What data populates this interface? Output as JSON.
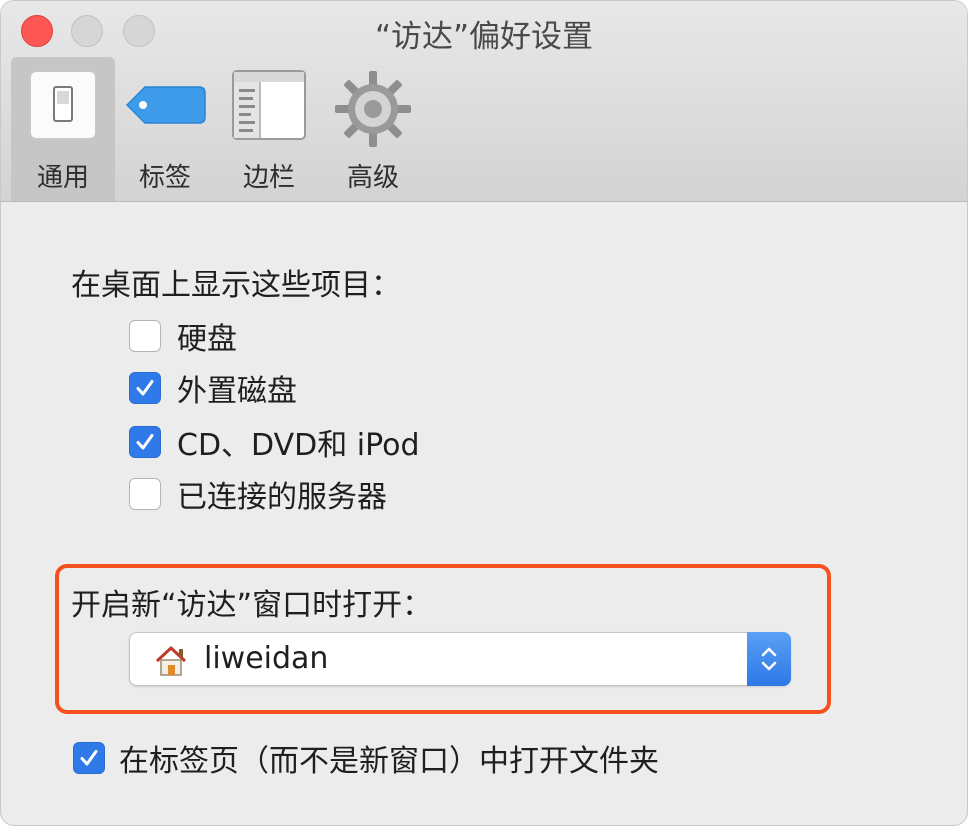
{
  "window": {
    "title": "“访达”偏好设置"
  },
  "toolbar": {
    "tabs": [
      {
        "label": "通用",
        "icon": "switch-icon",
        "selected": true
      },
      {
        "label": "标签",
        "icon": "tag-icon",
        "selected": false
      },
      {
        "label": "边栏",
        "icon": "sidebar-icon",
        "selected": false
      },
      {
        "label": "高级",
        "icon": "gear-icon",
        "selected": false
      }
    ]
  },
  "desktop_items": {
    "heading": "在桌面上显示这些项目：",
    "options": [
      {
        "label": "硬盘",
        "checked": false
      },
      {
        "label": "外置磁盘",
        "checked": true
      },
      {
        "label": "CD、DVD和 iPod",
        "checked": true
      },
      {
        "label": "已连接的服务器",
        "checked": false
      }
    ]
  },
  "new_window": {
    "heading": "开启新“访达”窗口时打开：",
    "selected_value": "liweidan",
    "value_icon": "home-icon"
  },
  "open_in_tabs": {
    "label": "在标签页（而不是新窗口）中打开文件夹",
    "checked": true
  },
  "colors": {
    "accent": "#2f79e8",
    "highlight": "#f4511e",
    "close": "#fc5753"
  }
}
